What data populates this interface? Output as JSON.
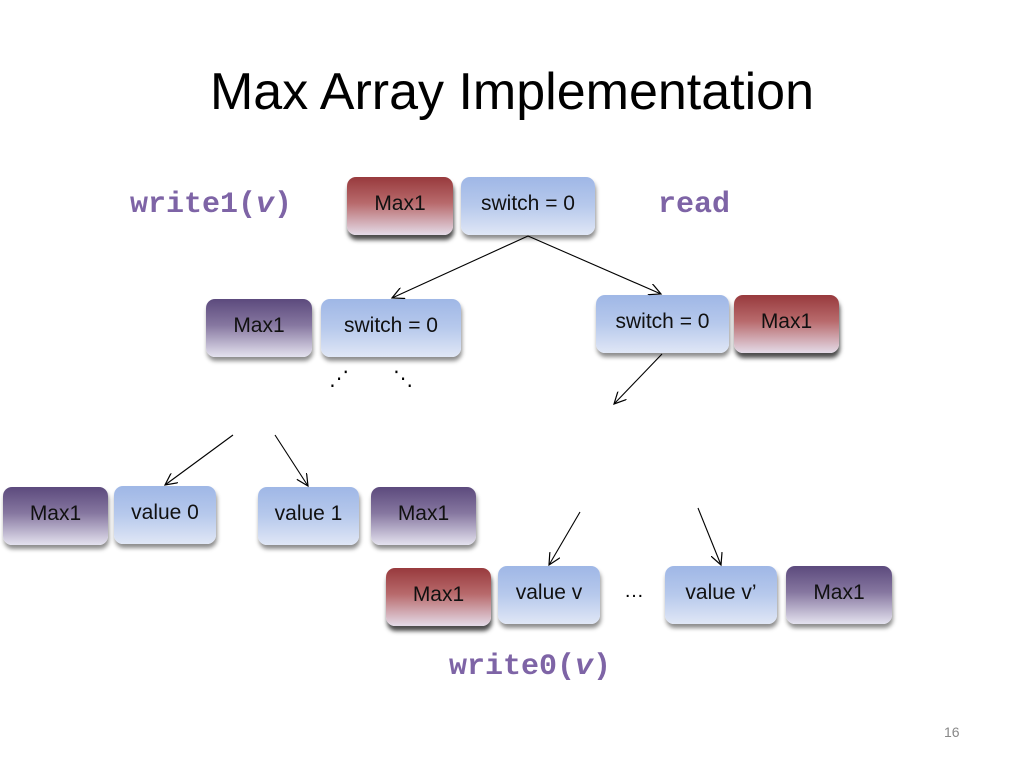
{
  "slide": {
    "title": "Max Array Implementation",
    "page_number": "16"
  },
  "labels": {
    "write1_prefix": "write1(",
    "write1_arg": "v",
    "write1_suffix": ")",
    "read": "read",
    "write0_prefix": "write0(",
    "write0_arg": "v",
    "write0_suffix": ")"
  },
  "nodes": {
    "root": {
      "max": "Max1",
      "switch": "switch = 0"
    },
    "left_inner": {
      "max": "Max1",
      "switch": "switch = 0"
    },
    "right_inner": {
      "switch": "switch = 0",
      "max": "Max1"
    },
    "leaf_left_0": {
      "max": "Max1",
      "value": "value 0"
    },
    "leaf_left_1": {
      "value": "value 1",
      "max": "Max1"
    },
    "leaf_right_v": {
      "max": "Max1",
      "value": "value v"
    },
    "leaf_right_vprime": {
      "value": "value v’",
      "max": "Max1"
    }
  },
  "ellipses": {
    "left_down": "⋰",
    "right_down": "⋱",
    "between_leaves": "…"
  },
  "colors": {
    "code_label": "#7e64a6",
    "switch_box": "#9fb7e6",
    "max_red": "#983a3d",
    "max_purple": "#5c4a7d"
  }
}
